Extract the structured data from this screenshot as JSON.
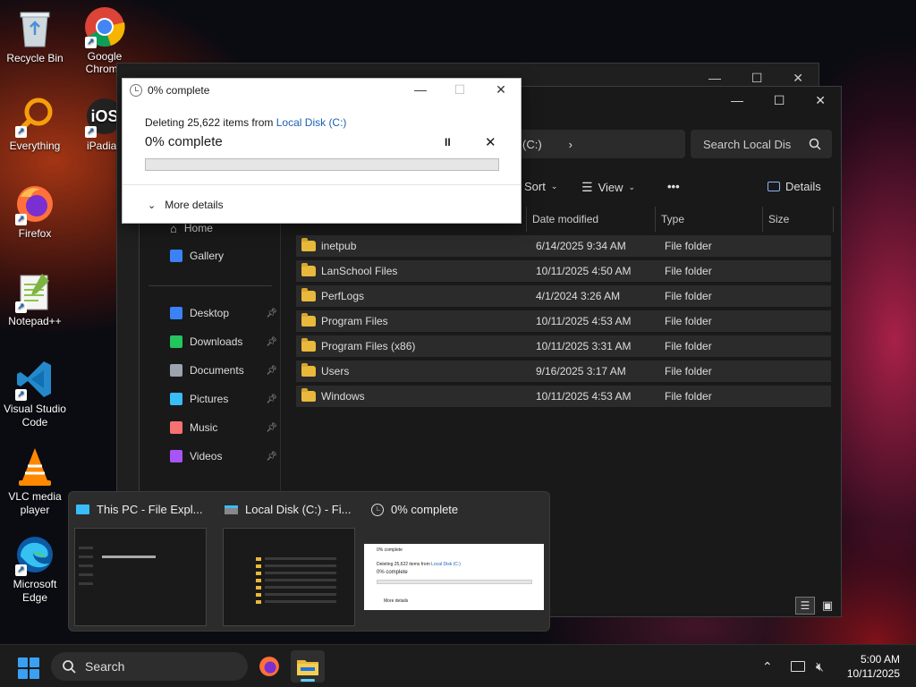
{
  "desktop": {
    "icons": [
      {
        "label": "Recycle Bin",
        "icon": "recycle-bin-icon"
      },
      {
        "label": "Google Chrome",
        "icon": "chrome-icon"
      },
      {
        "label": "Everything",
        "icon": "everything-icon"
      },
      {
        "label": "iPadian",
        "icon": "ipadian-icon",
        "glyph": "iOS"
      },
      {
        "label": "Firefox",
        "icon": "firefox-icon"
      },
      {
        "label": "Notepad++",
        "icon": "notepadpp-icon"
      },
      {
        "label": "Visual Studio Code",
        "icon": "vscode-icon"
      },
      {
        "label": "VLC media player",
        "icon": "vlc-icon"
      },
      {
        "label": "Microsoft Edge",
        "icon": "edge-icon"
      }
    ]
  },
  "explorer": {
    "address_tail": "(C:)",
    "search_placeholder": "Search Local Dis",
    "toolbar": {
      "sort": "Sort",
      "view": "View",
      "more": "•••",
      "details": "Details"
    },
    "columns": {
      "date": "Date modified",
      "type": "Type",
      "size": "Size"
    },
    "sidebar": {
      "home": "Home",
      "gallery": "Gallery",
      "pinned": [
        {
          "label": "Desktop",
          "color": "#3b82f6"
        },
        {
          "label": "Downloads",
          "color": "#22c55e"
        },
        {
          "label": "Documents",
          "color": "#9ca3af"
        },
        {
          "label": "Pictures",
          "color": "#38bdf8"
        },
        {
          "label": "Music",
          "color": "#f87171"
        },
        {
          "label": "Videos",
          "color": "#a855f7"
        }
      ]
    },
    "files": [
      {
        "name": "inetpub",
        "date": "6/14/2025 9:34 AM",
        "type": "File folder"
      },
      {
        "name": "LanSchool Files",
        "date": "10/11/2025 4:50 AM",
        "type": "File folder"
      },
      {
        "name": "PerfLogs",
        "date": "4/1/2024 3:26 AM",
        "type": "File folder"
      },
      {
        "name": "Program Files",
        "date": "10/11/2025 4:53 AM",
        "type": "File folder"
      },
      {
        "name": "Program Files (x86)",
        "date": "10/11/2025 3:31 AM",
        "type": "File folder"
      },
      {
        "name": "Users",
        "date": "9/16/2025 3:17 AM",
        "type": "File folder"
      },
      {
        "name": "Windows",
        "date": "10/11/2025 4:53 AM",
        "type": "File folder"
      }
    ]
  },
  "dialog": {
    "title": "0% complete",
    "desc_prefix": "Deleting 25,622 items from ",
    "desc_link": "Local Disk (C:)",
    "percent_text": "0% complete",
    "progress": 0,
    "more_details": "More details",
    "pause": "II",
    "cancel": "✕"
  },
  "flyout": {
    "thumbs": [
      {
        "title": "This PC - File Expl..."
      },
      {
        "title": "Local Disk (C:) - Fi..."
      },
      {
        "title": "0% complete"
      }
    ],
    "mini_dialog": {
      "title": "0% complete",
      "desc": "Deleting 25,622 items from",
      "link": "Local Disk (C:)",
      "pct": "0% complete",
      "more": "More details"
    }
  },
  "taskbar": {
    "search": "Search",
    "time": "5:00 AM",
    "date": "10/11/2025"
  }
}
